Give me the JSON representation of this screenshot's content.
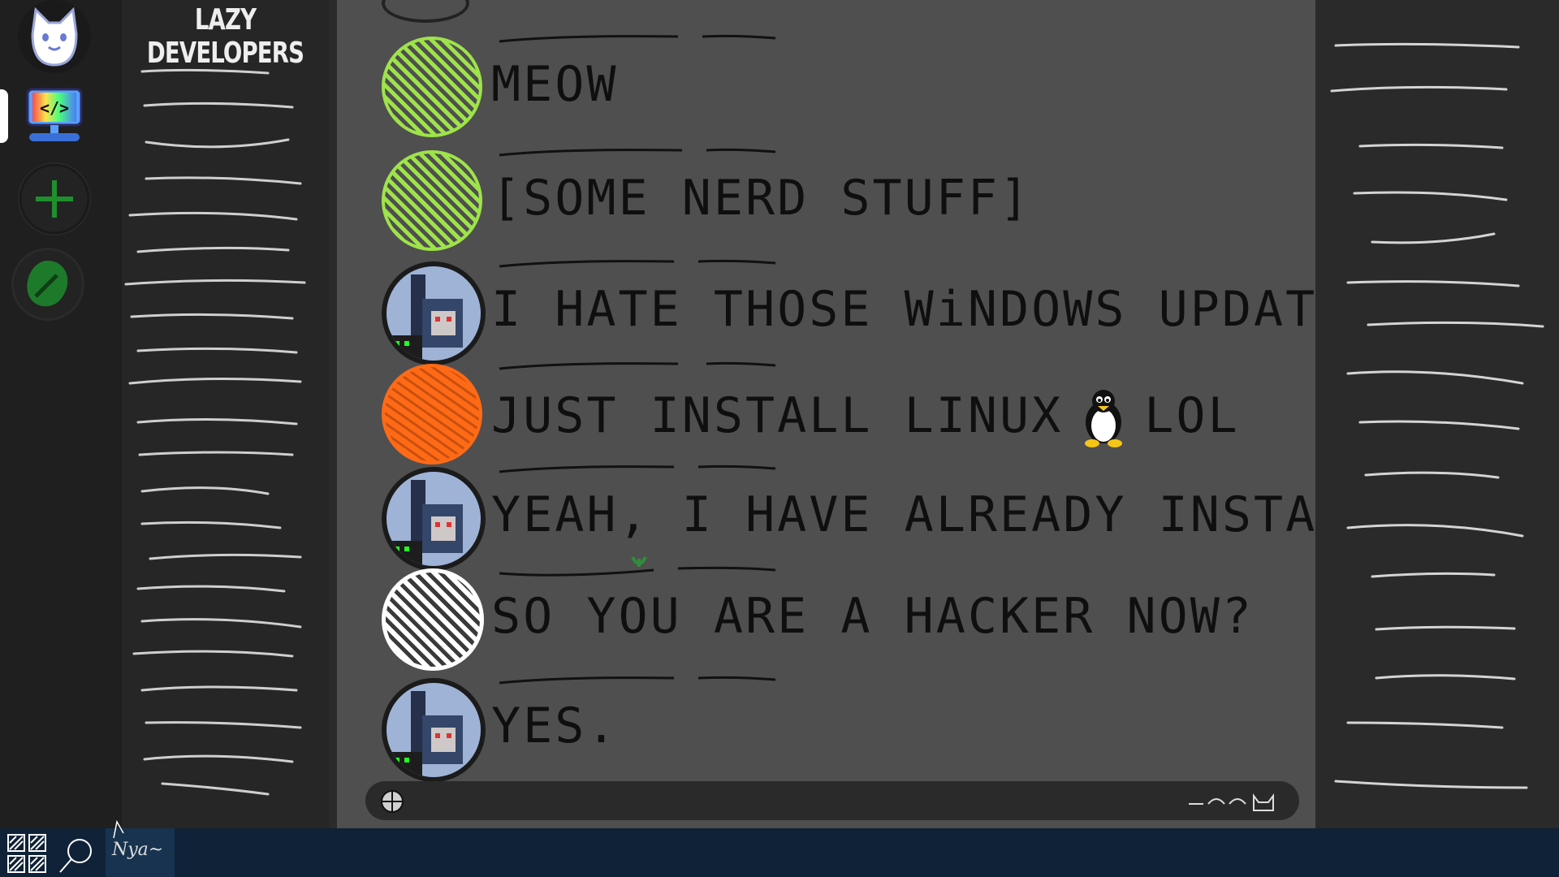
{
  "server": {
    "title": "LAZY DEVELOPERS"
  },
  "servers": [
    {
      "name": "cat-bot-icon"
    },
    {
      "name": "code-server-icon"
    },
    {
      "name": "add-server-icon"
    },
    {
      "name": "explore-icon"
    }
  ],
  "messages": [
    {
      "author_color": "#9ee34a",
      "text": "MEOW"
    },
    {
      "author_color": "#9ee34a",
      "text": "[SOME NERD STUFF]"
    },
    {
      "author_color": "pixel-avatar",
      "text": "I HATE THOSE WiNDOWS UPDATES"
    },
    {
      "author_color": "#ff6a16",
      "text": "JUST INSTALL LINUX",
      "emoji": "tux-icon",
      "text2": "LOL"
    },
    {
      "author_color": "pixel-avatar",
      "text": "YEAH, I HAVE ALREADY INSTALLED IT"
    },
    {
      "author_color": "#ffffff",
      "text": "SO YOU ARE A HACKER NOW?"
    },
    {
      "author_color": "pixel-avatar",
      "text": "YES."
    }
  ],
  "taskbar": {
    "app_label": "Nya~"
  },
  "colors": {
    "bg_chat": "#4f4f4f",
    "bg_rail": "#1f1f1f",
    "taskbar": "#0f2237",
    "green": "#9ee34a",
    "orange": "#ff6a16"
  }
}
